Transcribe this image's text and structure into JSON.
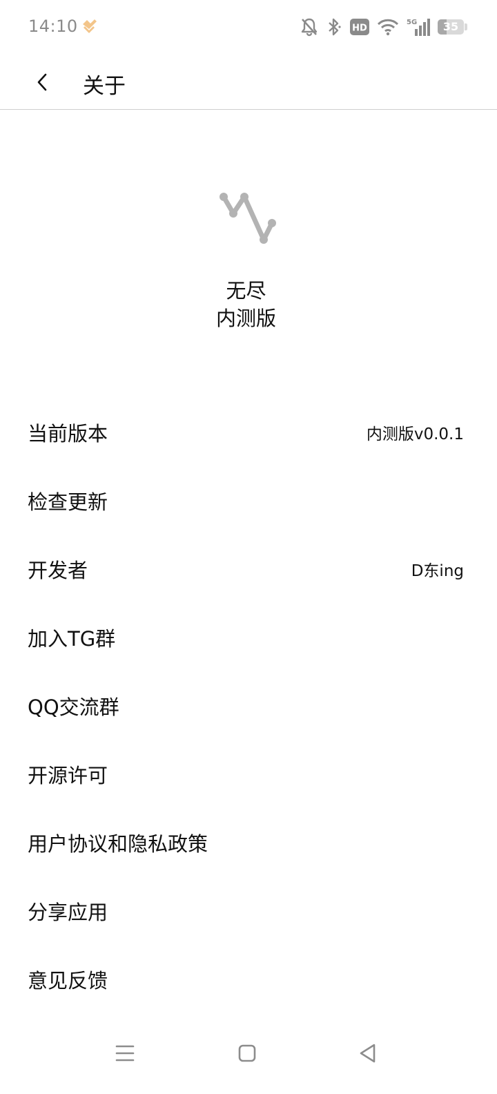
{
  "status_bar": {
    "time": "14:10",
    "hd_label": "HD",
    "network_label": "5G",
    "battery_level": "35",
    "icons": [
      "app-notification-icon",
      "mute-icon",
      "bluetooth-icon",
      "hd-icon",
      "wifi-icon",
      "signal-icon",
      "battery-icon"
    ]
  },
  "header": {
    "title": "关于",
    "back_icon": "back-chevron-icon"
  },
  "app": {
    "name": "无尽",
    "edition": "内测版",
    "logo_icon": "app-logo-icon"
  },
  "menu": {
    "items": [
      {
        "label": "当前版本",
        "value": "内测版v0.0.1"
      },
      {
        "label": "检查更新"
      },
      {
        "label": "开发者",
        "value": "D东ing"
      },
      {
        "label": "加入TG群"
      },
      {
        "label": "QQ交流群"
      },
      {
        "label": "开源许可"
      },
      {
        "label": "用户协议和隐私政策"
      },
      {
        "label": "分享应用"
      },
      {
        "label": "意见反馈"
      }
    ]
  },
  "nav_bar": {
    "icons": [
      "menu-icon",
      "home-icon",
      "back-icon"
    ]
  },
  "colors": {
    "status_text": "#8a8a8a",
    "app_notification": "#f3c58a",
    "divider": "#cfcfcf",
    "logo": "#b3b3b3",
    "nav_icons": "#8c8c8c"
  }
}
